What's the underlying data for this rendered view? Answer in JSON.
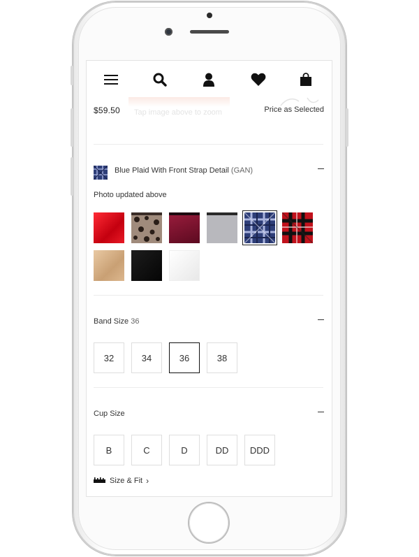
{
  "nav": {
    "icons": [
      "menu-icon",
      "search-icon",
      "account-icon",
      "heart-icon",
      "bag-icon"
    ]
  },
  "product": {
    "price": "$59.50",
    "zoom_hint": "Tap image above to zoom",
    "price_note": "Price as Selected"
  },
  "color": {
    "name": "Blue Plaid With Front Strap Detail",
    "code": "(GAN)",
    "photo_note": "Photo updated above",
    "swatches": [
      {
        "name": "red",
        "color": "#e0101e"
      },
      {
        "name": "leopard-lace",
        "color": "#8a7466"
      },
      {
        "name": "burgundy-lace",
        "color": "#7b1530"
      },
      {
        "name": "grey",
        "color": "#b8b8bd"
      },
      {
        "name": "blue-plaid",
        "color": "#2e3e78"
      },
      {
        "name": "red-plaid",
        "color": "#c1121c"
      },
      {
        "name": "nude",
        "color": "#d9b58d"
      },
      {
        "name": "black",
        "color": "#0d0d0d"
      },
      {
        "name": "white",
        "color": "#f1f1f1"
      }
    ],
    "selected_index": 4
  },
  "band": {
    "label": "Band Size",
    "value": "36",
    "options": [
      "32",
      "34",
      "36",
      "38"
    ],
    "selected": "36"
  },
  "cup": {
    "label": "Cup Size",
    "options": [
      "B",
      "C",
      "D",
      "DD",
      "DDD"
    ]
  },
  "fit_link": {
    "label": "Size & Fit",
    "chevron": "›"
  },
  "colors": {
    "text": "#333333",
    "border": "#dedede",
    "selected_border": "#111111"
  }
}
